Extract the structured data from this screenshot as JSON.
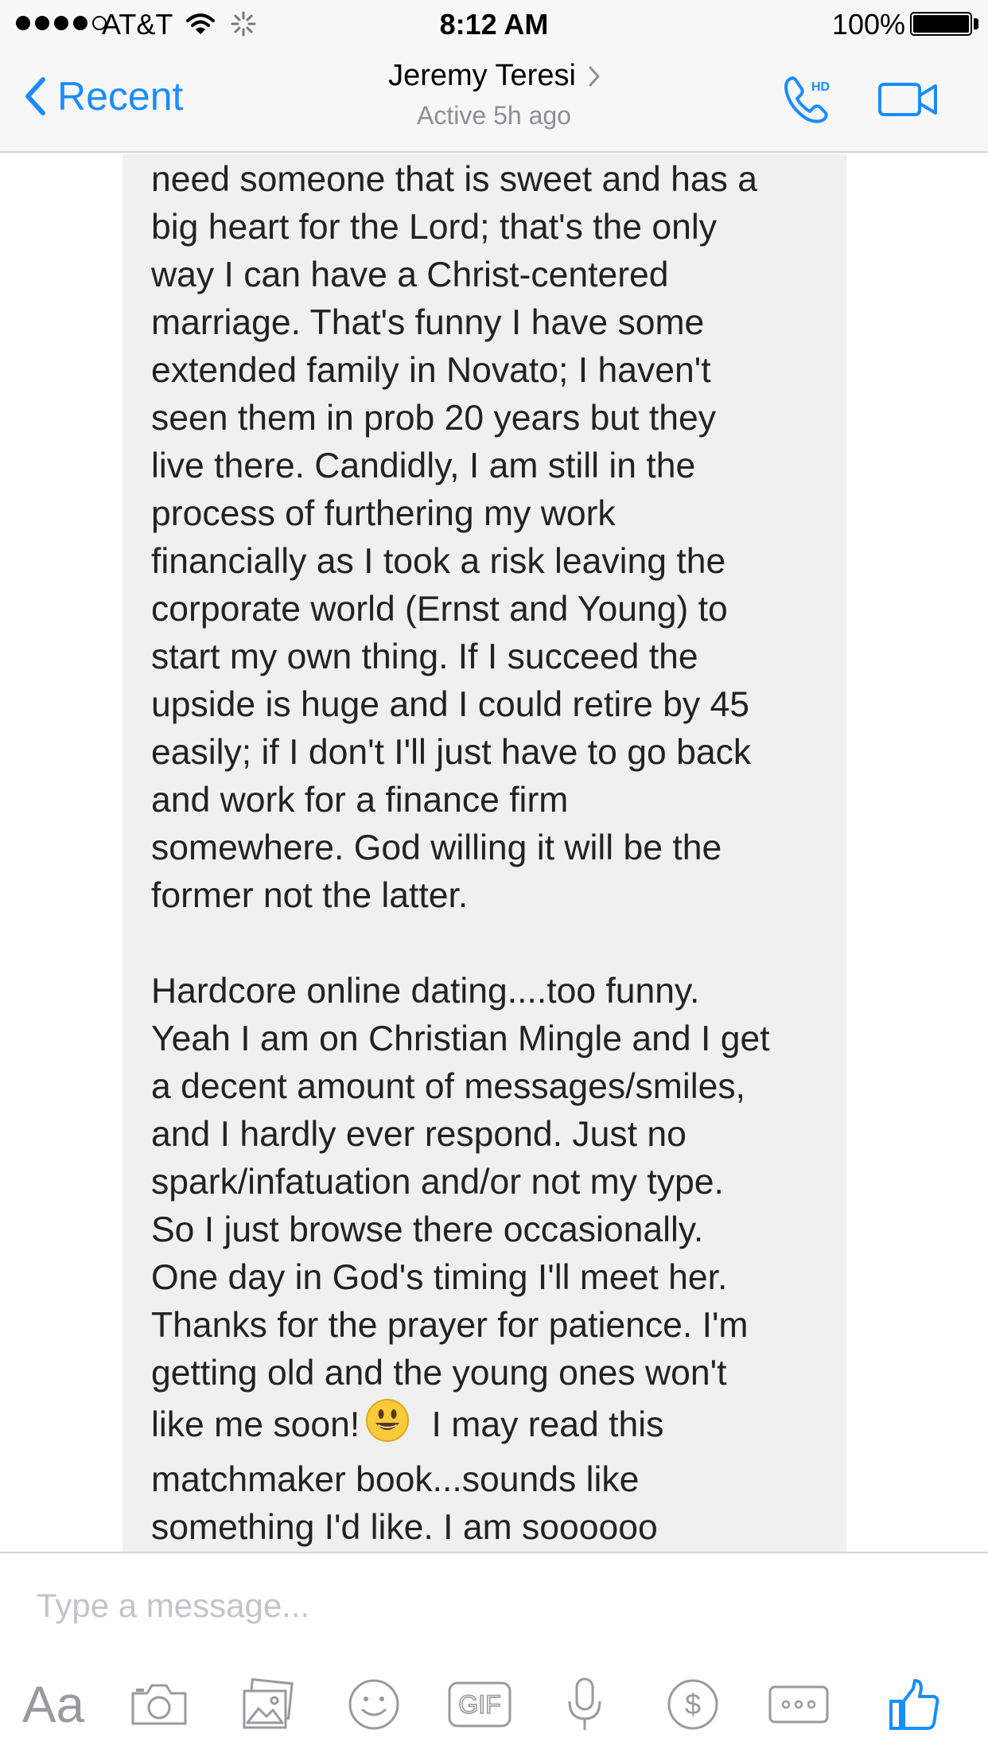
{
  "status_bar": {
    "carrier": "AT&T",
    "time": "8:12 AM",
    "battery_percent": "100%",
    "signal_bars": 4,
    "battery_level": 1.0
  },
  "nav": {
    "back_label": "Recent",
    "contact_name": "Jeremy Teresi",
    "contact_status": "Active 5h ago",
    "call_badge": "HD",
    "icons": [
      "chevron-left-icon",
      "chevron-right-icon",
      "phone-hd-icon",
      "video-camera-icon"
    ]
  },
  "message": {
    "text_before_emoji": "need someone that is sweet and has a\nbig heart for the Lord; that's the only\nway I can have a Christ-centered\nmarriage.  That's funny I have some\nextended family in Novato; I haven't\nseen them in prob 20 years but they\nlive there.  Candidly, I am still in the\nprocess of furthering my work\nfinancially as I took a risk leaving the\ncorporate world (Ernst and Young) to\nstart my own thing.  If I succeed the\nupside is huge and I could retire by 45\neasily; if I don't I'll just have to go back\nand work for a finance firm\nsomewhere.  God willing it will be the\nformer not the latter.\n\nHardcore online dating....too funny.\nYeah I am on Christian Mingle and I get\na decent amount of messages/smiles,\nand I hardly ever respond.  Just no\nspark/infatuation and/or not my type.\nSo I just browse there occasionally.\nOne day in God's timing I'll meet her.\nThanks for the prayer for patience.  I'm\ngetting old and the young ones won't\nlike me soon!",
    "emoji": "smiley-face-emoji",
    "text_after_emoji": " I may read this\nmatchmaker book...sounds like\nsomething I'd like.  I am soooooo"
  },
  "composer": {
    "placeholder": "Type a message...",
    "value": "",
    "aa_label": "Aa",
    "gif_label": "GIF",
    "tools": [
      "text-format-button",
      "camera-icon",
      "photo-gallery-icon",
      "emoji-icon",
      "gif-icon",
      "microphone-icon",
      "payment-dollar-icon",
      "more-options-icon",
      "like-thumbs-up-icon"
    ],
    "accent_color": "#1a8cff",
    "inactive_icon_color": "#9a9a9e"
  }
}
